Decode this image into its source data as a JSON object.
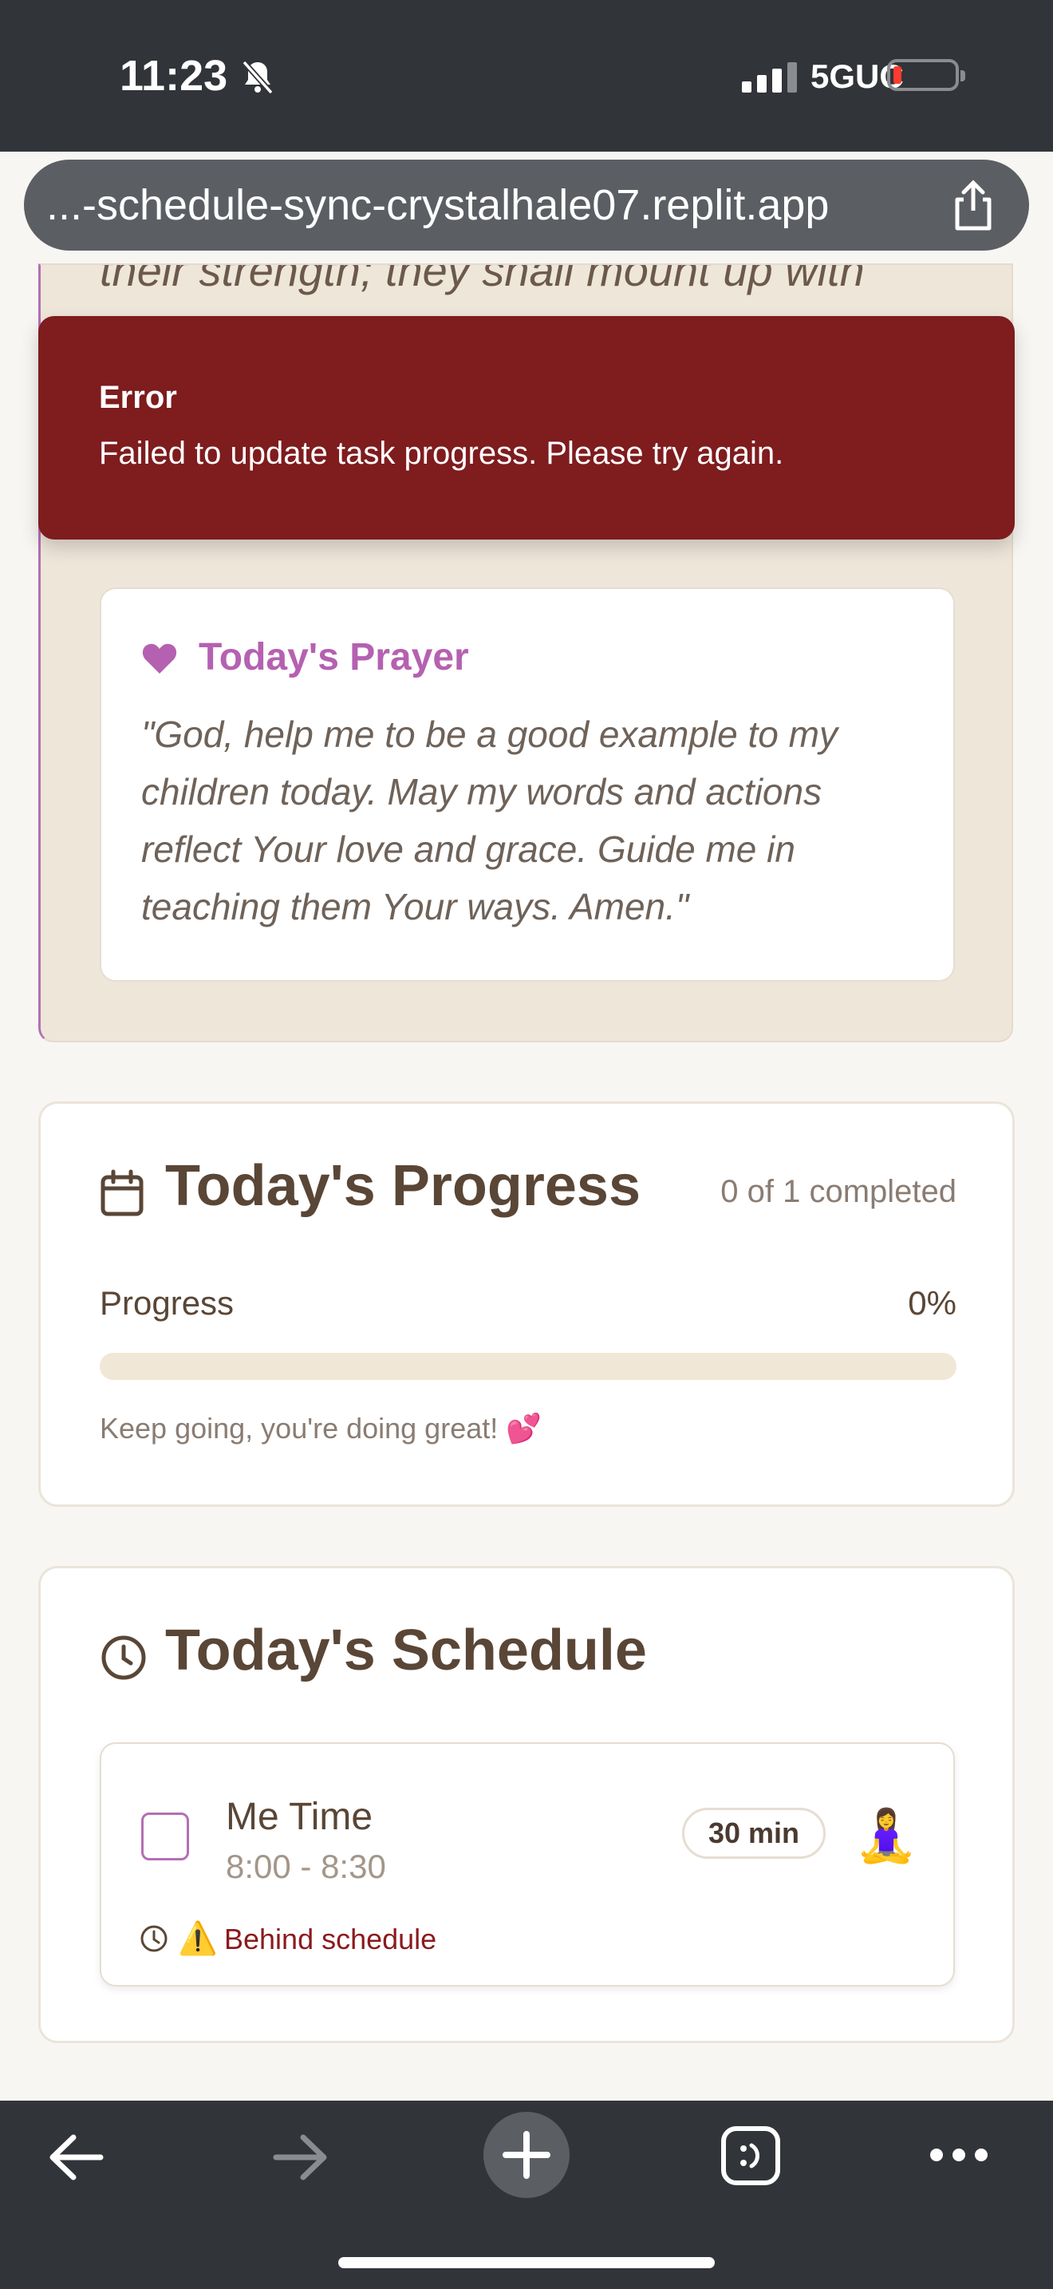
{
  "status_bar": {
    "time": "11:23",
    "network": "5GUC",
    "battery_level": 0.1
  },
  "browser": {
    "url": "...-schedule-sync-crystalhale07.replit.app"
  },
  "verse": {
    "text": "their strength; they shall mount up with"
  },
  "error_toast": {
    "title": "Error",
    "message": "Failed to update task progress. Please try again."
  },
  "prayer": {
    "title": "Today's Prayer",
    "text": "\"God, help me to be a good example to my children today. May my words and actions reflect Your love and grace. Guide me in teaching them Your ways. Amen.\""
  },
  "progress": {
    "title": "Today's Progress",
    "completed_text": "0 of 1 completed",
    "label": "Progress",
    "percent_text": "0%",
    "value": 0,
    "encouragement": "Keep going, you're doing great! 💕"
  },
  "schedule": {
    "title": "Today's Schedule",
    "tasks": [
      {
        "name": "Me Time",
        "time": "8:00 - 8:30",
        "duration": "30 min",
        "emoji": "🧘‍♀️",
        "warning_icon": "⚠️",
        "status": "Behind schedule",
        "checked": false
      }
    ]
  },
  "colors": {
    "accent": "#b46fb5",
    "error": "#7e1c1e",
    "text": "#5a4636"
  }
}
